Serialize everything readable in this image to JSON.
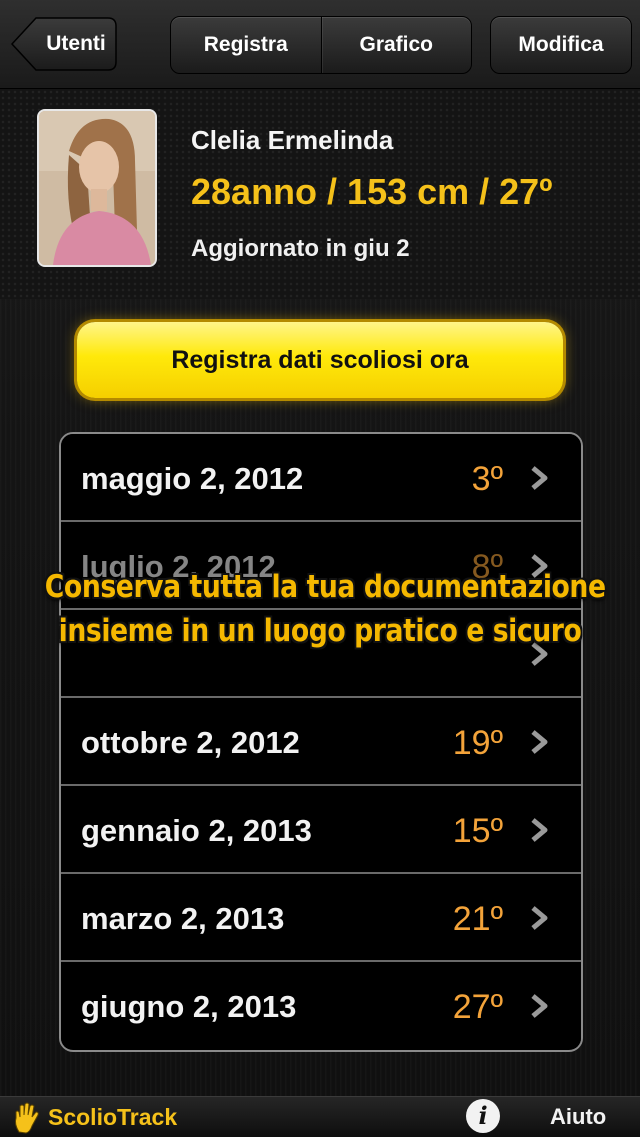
{
  "nav": {
    "back_label": "Utenti",
    "segments": [
      "Registra",
      "Grafico"
    ],
    "edit_label": "Modifica"
  },
  "profile": {
    "name": "Clelia Ermelinda",
    "stats": "28anno / 153 cm / 27º",
    "updated": "Aggiornato in giu 2"
  },
  "record_button": "Registra dati scoliosi ora",
  "records": [
    {
      "date": "maggio 2, 2012",
      "angle": "3º"
    },
    {
      "date": "luglio 2, 2012",
      "angle": "8º"
    },
    {
      "date": "",
      "angle": ""
    },
    {
      "date": "ottobre 2, 2012",
      "angle": "19º"
    },
    {
      "date": "gennaio 2, 2013",
      "angle": "15º"
    },
    {
      "date": "marzo 2, 2013",
      "angle": "21º"
    },
    {
      "date": "giugno 2, 2013",
      "angle": "27º"
    }
  ],
  "banner": {
    "line1": "Conserva tutta la tua documentazione",
    "line2": "insieme in un luogo pratico e sicuro"
  },
  "bottom": {
    "brand": "ScolioTrack",
    "help": "Aiuto"
  },
  "colors": {
    "accent_yellow": "#f5c11a",
    "angle_orange": "#f3a33a",
    "banner_yellow": "#f5b800"
  },
  "icons": [
    "back-arrow-icon",
    "chevron-right-icon",
    "hand-logo-icon",
    "info-icon"
  ]
}
